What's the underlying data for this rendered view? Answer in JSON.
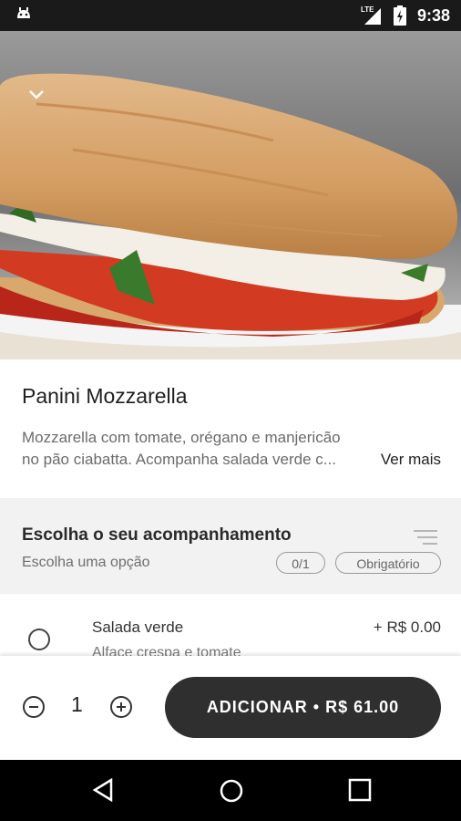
{
  "status_bar": {
    "time": "9:38",
    "network": "LTE"
  },
  "product": {
    "title": "Panini Mozzarella",
    "description": "Mozzarella com tomate, orégano e manjericão no pão ciabatta. Acompanha salada verde c...",
    "more_link": "Ver mais"
  },
  "options_section": {
    "heading": "Escolha o seu acompanhamento",
    "subheading": "Escolha uma opção",
    "count_badge": "0/1",
    "required_badge": "Obrigatório",
    "items": [
      {
        "name": "Salada verde",
        "price": "+ R$ 0.00",
        "description": "Alface crespa e tomate"
      }
    ]
  },
  "bottom_bar": {
    "quantity": "1",
    "add_button": "ADICIONAR • R$ 61.00"
  },
  "colors": {
    "button": "#2f2f2f",
    "section_bg": "#f2f2f2"
  }
}
